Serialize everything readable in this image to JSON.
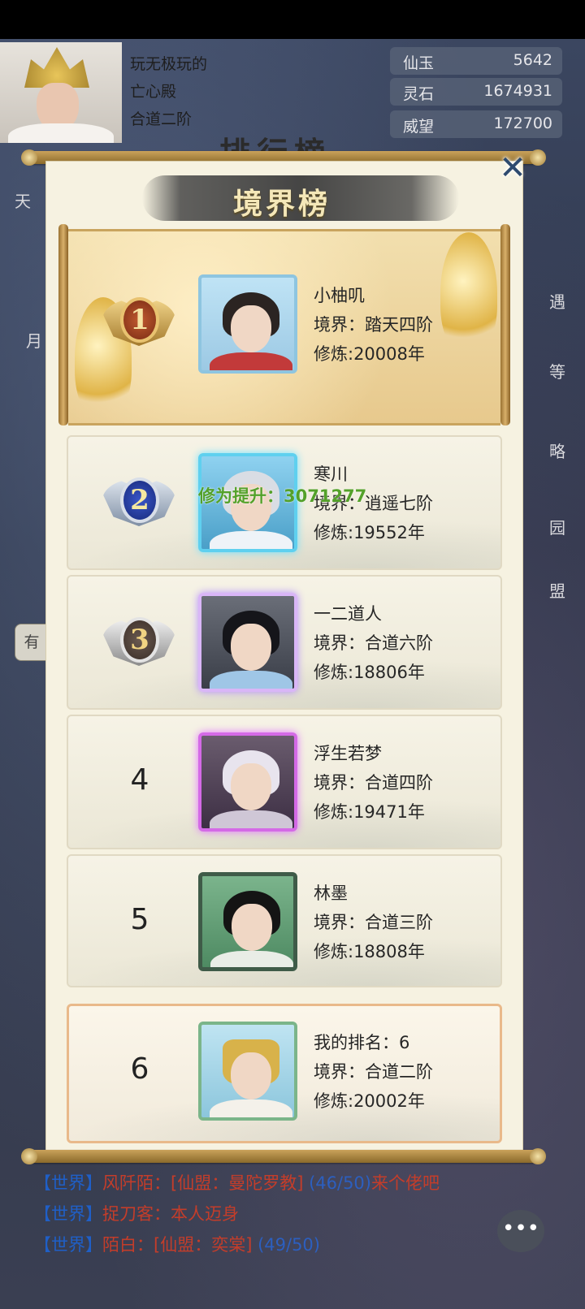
{
  "player": {
    "line1": "玩无极玩的",
    "line2": "亡心殿",
    "line3": "合道二阶"
  },
  "resources": [
    {
      "label": "仙玉",
      "value": "5642"
    },
    {
      "label": "灵石",
      "value": "1674931"
    },
    {
      "label": "威望",
      "value": "172700"
    }
  ],
  "background_title": "排行榜",
  "panel": {
    "title": "境界榜",
    "close_symbol": "✕"
  },
  "floating_text": "修为提升：3071277",
  "rankings": [
    {
      "rank": "1",
      "name": "小柚叽",
      "realm": "境界：踏天四阶",
      "cultivation": "修炼:20008年"
    },
    {
      "rank": "2",
      "name": "寒川",
      "realm": "境界：逍遥七阶",
      "cultivation": "修炼:19552年"
    },
    {
      "rank": "3",
      "name": "一二道人",
      "realm": "境界：合道六阶",
      "cultivation": "修炼:18806年"
    },
    {
      "rank": "4",
      "name": "浮生若梦",
      "realm": "境界：合道四阶",
      "cultivation": "修炼:19471年"
    },
    {
      "rank": "5",
      "name": "林墨",
      "realm": "境界：合道三阶",
      "cultivation": "修炼:18808年"
    }
  ],
  "my_rank": {
    "rank": "6",
    "label": "我的排名：6",
    "realm": "境界：合道二阶",
    "cultivation": "修炼:20002年"
  },
  "chat": [
    {
      "tag": "【世界】",
      "who": "风阡陌：",
      "msg": "[仙盟：曼陀罗教]",
      "extra": "(46/50)",
      "tail": "来个佬吧"
    },
    {
      "tag": "【世界】",
      "who": "捉刀客：",
      "msg": "本人迈身",
      "extra": "",
      "tail": ""
    },
    {
      "tag": "【世界】",
      "who": "陌白：",
      "msg": "[仙盟：奕棠]",
      "extra": "(49/50)",
      "tail": ""
    }
  ],
  "side_tags": {
    "left": [
      "天",
      "月"
    ],
    "left_button": "有",
    "right": [
      "遇",
      "等",
      "略",
      "园",
      "盟"
    ]
  },
  "chat_button_icon": "chat-bubble-icon"
}
